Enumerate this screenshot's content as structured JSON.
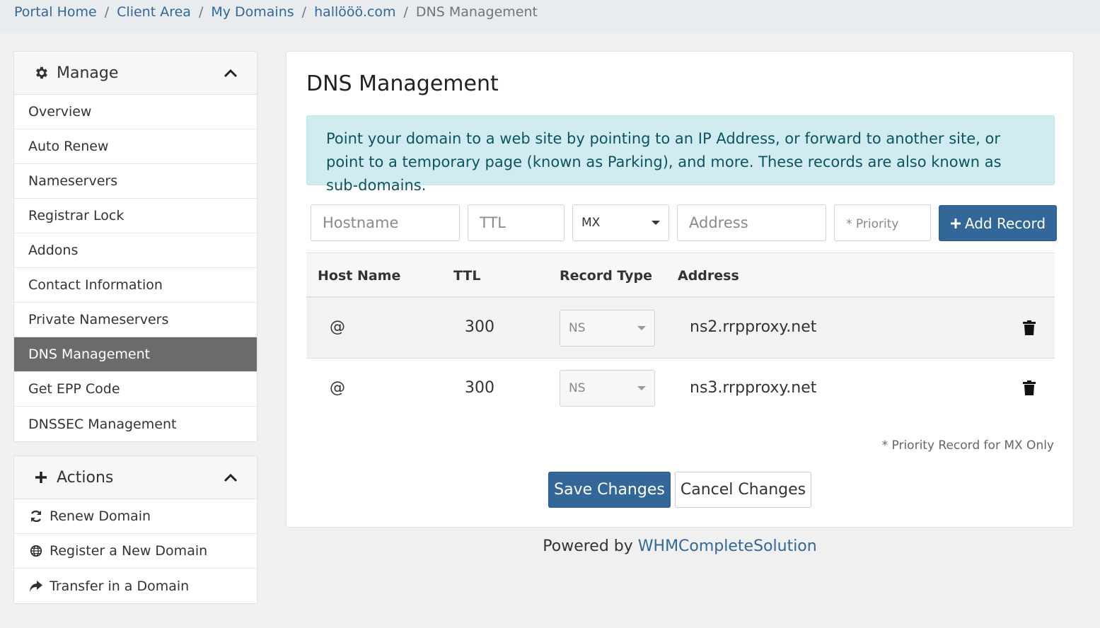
{
  "breadcrumb": [
    "Portal Home",
    "Client Area",
    "My Domains",
    "hallööö.com",
    "DNS Management"
  ],
  "manage_panel": {
    "title": "Manage",
    "items": [
      "Overview",
      "Auto Renew",
      "Nameservers",
      "Registrar Lock",
      "Addons",
      "Contact Information",
      "Private Nameservers",
      "DNS Management",
      "Get EPP Code",
      "DNSSEC Management"
    ],
    "active": "DNS Management"
  },
  "actions_panel": {
    "title": "Actions",
    "items": [
      {
        "label": "Renew Domain",
        "icon": "refresh-icon"
      },
      {
        "label": "Register a New Domain",
        "icon": "globe-icon"
      },
      {
        "label": "Transfer in a Domain",
        "icon": "share-icon"
      }
    ]
  },
  "main": {
    "title": "DNS Management",
    "info": "Point your domain to a web site by pointing to an IP Address, or forward to another site, or point to a temporary page (known as Parking), and more. These records are also known as sub-domains.",
    "add_form": {
      "hostname_placeholder": "Hostname",
      "ttl_placeholder": "TTL",
      "type_value": "MX",
      "address_placeholder": "Address",
      "priority_placeholder": "* Priority",
      "add_button": "Add Record"
    },
    "table": {
      "headers": [
        "Host Name",
        "TTL",
        "Record Type",
        "Address"
      ],
      "rows": [
        {
          "host": "@",
          "ttl": "300",
          "type": "NS",
          "address": "ns2.rrpproxy.net"
        },
        {
          "host": "@",
          "ttl": "300",
          "type": "NS",
          "address": "ns3.rrpproxy.net"
        }
      ]
    },
    "priority_note": "* Priority Record for MX Only",
    "save_button": "Save Changes",
    "cancel_button": "Cancel Changes"
  },
  "footer": {
    "prefix": "Powered by",
    "link": "WHMCompleteSolution"
  },
  "colors": {
    "primary": "#336699",
    "info_bg": "#d1ecf1",
    "info_text": "#0c5460",
    "active_item": "#6b6b6b"
  }
}
